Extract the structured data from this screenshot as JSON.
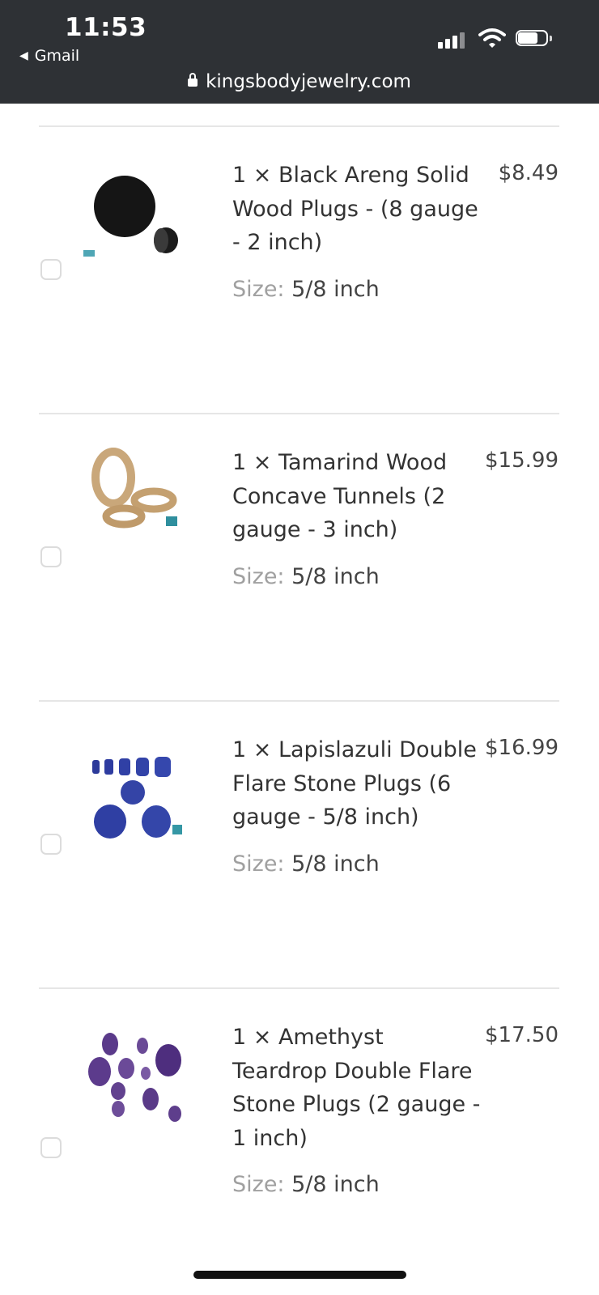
{
  "status_bar": {
    "time": "11:53",
    "back_app": "Gmail",
    "url": "kingsbodyjewelry.com"
  },
  "items": [
    {
      "title": "1 × Black Areng Solid Wood Plugs - (8 gauge - 2 inch)",
      "price": "$8.49",
      "size_label": "Size:",
      "size_value": "5/8 inch",
      "checked": false
    },
    {
      "title": "1 × Tamarind Wood Concave Tunnels (2 gauge - 3 inch)",
      "price": "$15.99",
      "size_label": "Size:",
      "size_value": "5/8 inch",
      "checked": false
    },
    {
      "title": "1 × Lapislazuli Double Flare Stone Plugs (6 gauge - 5/8 inch)",
      "price": "$16.99",
      "size_label": "Size:",
      "size_value": "5/8 inch",
      "checked": false
    },
    {
      "title": "1 × Amethyst Teardrop Double Flare Stone Plugs (2 gauge - 1 inch)",
      "price": "$17.50",
      "size_label": "Size:",
      "size_value": "5/8 inch",
      "checked": false
    }
  ]
}
